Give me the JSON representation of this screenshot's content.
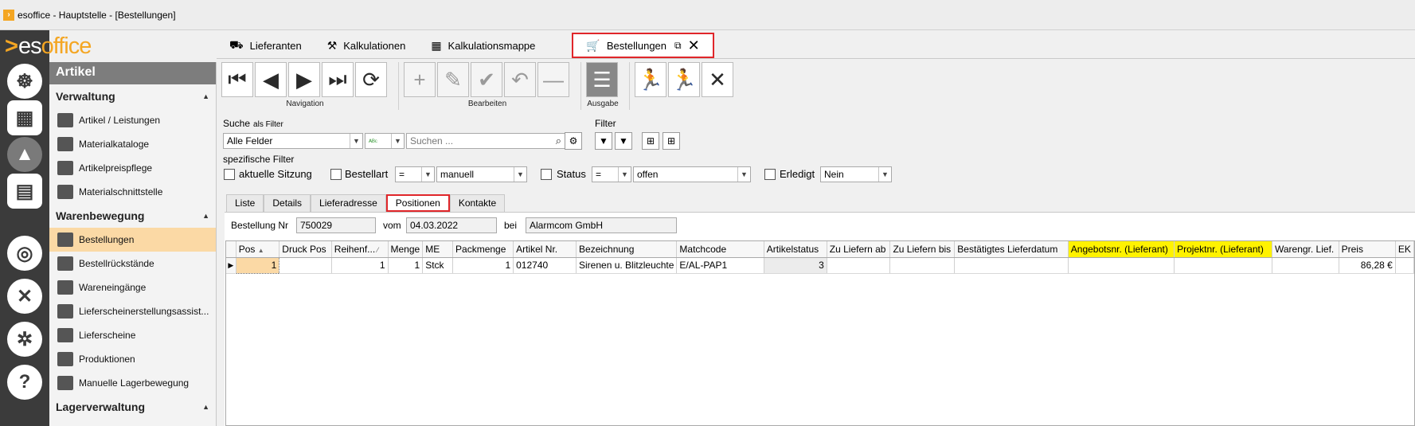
{
  "window": {
    "title": "esoffice - Hauptstelle - [Bestellungen]"
  },
  "brand": {
    "chev": ">",
    "es": "es",
    "office": "office"
  },
  "rail": [
    {
      "name": "helm-icon"
    },
    {
      "name": "calculator-icon"
    },
    {
      "name": "alarm-icon"
    },
    {
      "name": "money-icon"
    },
    {
      "name": "headset-icon"
    },
    {
      "name": "tools-icon"
    },
    {
      "name": "gears-icon"
    },
    {
      "name": "help-icon"
    }
  ],
  "sidebar": {
    "header": "Artikel",
    "sections": {
      "verwaltung": "Verwaltung",
      "warenbewegung": "Warenbewegung",
      "lagerverwaltung": "Lagerverwaltung"
    },
    "verwaltung_items": [
      "Artikel / Leistungen",
      "Materialkataloge",
      "Artikelpreispflege",
      "Materialschnittstelle"
    ],
    "warenbewegung_items": [
      "Bestellungen",
      "Bestellrückstände",
      "Wareneingänge",
      "Lieferscheinerstellungsassist...",
      "Lieferscheine",
      "Produktionen",
      "Manuelle Lagerbewegung"
    ]
  },
  "tabs": [
    "Lieferanten",
    "Kalkulationen",
    "Kalkulationsmappe",
    "Bestellungen"
  ],
  "toolbar": {
    "navigation_label": "Navigation",
    "bearbeiten_label": "Bearbeiten",
    "ausgabe_label": "Ausgabe"
  },
  "search": {
    "label": "Suche",
    "as_filter": "als Filter",
    "field": "Alle Felder",
    "placeholder": "Suchen ..."
  },
  "filter": {
    "label": "Filter"
  },
  "specific": {
    "label": "spezifische Filter",
    "current_session": "aktuelle Sitzung",
    "bestellart_label": "Bestellart",
    "bestellart_op": "=",
    "bestellart_value": "manuell",
    "status_label": "Status",
    "status_op": "=",
    "status_value": "offen",
    "erledigt_label": "Erledigt",
    "erledigt_value": "Nein"
  },
  "subtabs": [
    "Liste",
    "Details",
    "Lieferadresse",
    "Positionen",
    "Kontakte"
  ],
  "order": {
    "nr_label": "Bestellung Nr",
    "nr": "750029",
    "vom_label": "vom",
    "date": "04.03.2022",
    "bei_label": "bei",
    "supplier": "Alarmcom GmbH"
  },
  "grid": {
    "columns": [
      "Pos",
      "Druck Pos",
      "Reihenf...",
      "Menge",
      "ME",
      "Packmenge",
      "Artikel Nr.",
      "Bezeichnung",
      "Matchcode",
      "Artikelstatus",
      "Zu Liefern ab",
      "Zu Liefern bis",
      "Bestätigtes Lieferdatum",
      "Angebotsnr. (Lieferant)",
      "Projektnr. (Lieferant)",
      "Warengr. Lief.",
      "Preis",
      "EK"
    ],
    "rows": [
      [
        "1",
        "",
        "1",
        "1",
        "Stck",
        "1",
        "012740",
        "Sirenen u. Blitzleuchte",
        "E/AL-PAP1",
        "3",
        "",
        "",
        "",
        "",
        "",
        "",
        "86,28 €",
        ""
      ]
    ]
  }
}
